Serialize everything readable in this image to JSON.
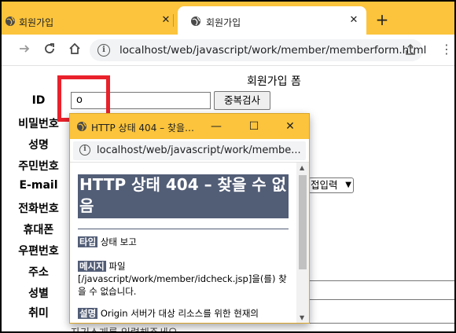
{
  "browser": {
    "tabs": [
      {
        "title": "회원가입",
        "active": false
      },
      {
        "title": "회원가입",
        "active": true
      }
    ],
    "new_tab_label": "+",
    "close_glyph": "✕",
    "url": "localhost/web/javascript/work/member/memberform.html",
    "icons": {
      "back": "arrow-right-icon",
      "reload": "reload-icon",
      "home": "home-icon",
      "site_info": "info-icon",
      "share": "share-icon",
      "menu": "menu-icon"
    }
  },
  "form": {
    "title": "회원가입 폼",
    "labels": [
      "ID",
      "비밀번호",
      "성명",
      "주민번호",
      "E-mail",
      "전화번호",
      "휴대폰",
      "우편번호",
      "주소",
      "성별",
      "취미"
    ],
    "id_value": "o",
    "check_button": "중복검사",
    "email_select_visible": "접입력",
    "textarea_placeholder": "자기소개를 입력해주세요"
  },
  "popup": {
    "window_title": "HTTP 상태 404 – 찾을…",
    "url": "localhost/web/javascript/work/membe...",
    "heading": "HTTP 상태 404 – 찾을 수 없음",
    "type_label": "타입",
    "type_text": "상태 보고",
    "message_label": "메시지",
    "message_text": "파일 [/javascript/work/member/idcheck.jsp]을(를) 찾을 수 없습니다.",
    "desc_label": "설명",
    "desc_text": "Origin 서버가 대상 리소스를 위한 현재의",
    "controls": {
      "minimize": "—",
      "maximize": "☐",
      "close": "✕"
    }
  },
  "colors": {
    "chrome_yellow": "#fbc43c",
    "error_header": "#525d76",
    "highlight_red": "#e8212b"
  }
}
